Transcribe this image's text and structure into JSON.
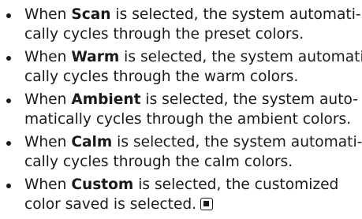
{
  "items": [
    {
      "line1_pre": "When ",
      "keyword": "Scan",
      "line1_post": " is selected, the system automati-",
      "line2": "cally cycles through the preset colors."
    },
    {
      "line1_pre": "When ",
      "keyword": "Warm",
      "line1_post": " is selected, the system automati-",
      "line2": "cally cycles through the warm colors."
    },
    {
      "line1_pre": "When ",
      "keyword": "Ambient",
      "line1_post": " is selected, the system auto-",
      "line2": "matically cycles through the ambient colors."
    },
    {
      "line1_pre": "When ",
      "keyword": "Calm",
      "line1_post": " is selected, the system automati-",
      "line2": "cally cycles through the calm colors."
    },
    {
      "line1_pre": "When ",
      "keyword": "Custom",
      "line1_post": " is selected, the customized",
      "line2": "color saved is selected."
    }
  ],
  "end_mark_icon": "section-end-icon"
}
